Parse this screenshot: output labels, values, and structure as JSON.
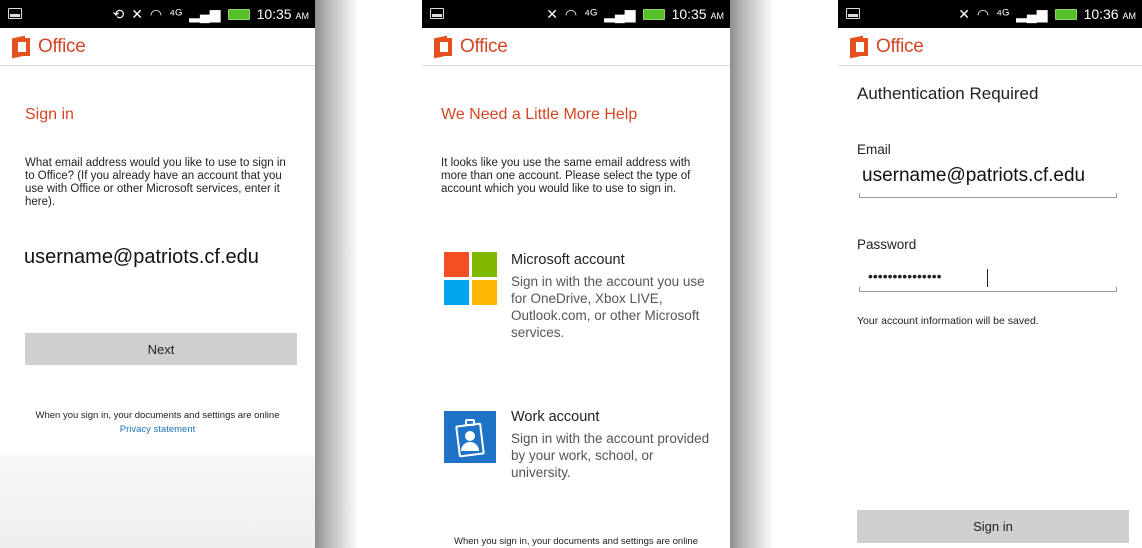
{
  "screens": [
    {
      "status_time": "10:35",
      "status_ampm": "AM",
      "app_name": "Office",
      "title": "Sign in",
      "prompt": "What email address would you like to use to sign in to Office? (If you already have an account that you use with Office or other Microsoft services, enter it here).",
      "email_value": "username@patriots.cf.edu",
      "next_label": "Next",
      "footer": "When you sign in, your documents and settings are online",
      "privacy_link": "Privacy statement"
    },
    {
      "status_time": "10:35",
      "status_ampm": "AM",
      "app_name": "Office",
      "title": "We Need a Little More Help",
      "prompt": "It looks like you use the same email address with more than one account. Please select the type of account which you would like to use to sign in.",
      "accounts": [
        {
          "title": "Microsoft account",
          "description": "Sign in with the account you use for OneDrive, Xbox LIVE, Outlook.com, or other Microsoft services.",
          "icon": "microsoft-logo-icon"
        },
        {
          "title": "Work account",
          "description": "Sign in with the account provided by your work, school, or university.",
          "icon": "id-badge-icon"
        }
      ],
      "footer": "When you sign in, your documents and settings are online"
    },
    {
      "status_time": "10:36",
      "status_ampm": "AM",
      "app_name": "Office",
      "title": "Authentication Required",
      "email_label": "Email",
      "email_value": "username@patriots.cf.edu",
      "password_label": "Password",
      "password_mask": "•••••••••••••••",
      "note": "Your account information will be saved.",
      "signin_label": "Sign in"
    }
  ],
  "colors": {
    "office_orange": "#d24726",
    "link_blue": "#1a73b8",
    "button_gray": "#cfcfcf",
    "battery_green": "#55c02a"
  }
}
